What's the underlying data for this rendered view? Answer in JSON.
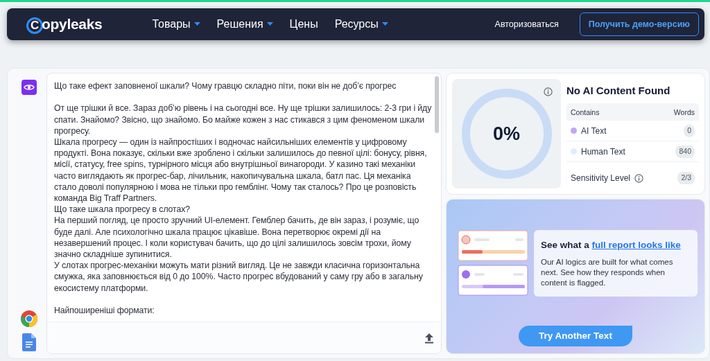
{
  "navbar": {
    "logo": "Copyleaks",
    "items": [
      {
        "label": "Товары",
        "dropdown": true
      },
      {
        "label": "Решения",
        "dropdown": true
      },
      {
        "label": "Цены",
        "dropdown": false
      },
      {
        "label": "Ресурсы",
        "dropdown": true
      }
    ],
    "login": "Авторизоваться",
    "demo_button": "Получить демо-версию"
  },
  "editor": {
    "paragraphs": [
      "Що таке ефект заповненої шкали? Чому гравцю складно піти, поки він не доб’є прогрес",
      "От ще трішки й все. Зараз доб’ю рівень і на сьогодні все. Ну ще трішки залишилось: 2-3 гри і йду спати. Знайомо? Звісно, що знайомо. Бо майже кожен з нас стикався з цим феноменом шкали прогресу.",
      "Шкала прогресу — один із найпростіших і водночас найсильніших елементів у цифровому продукті. Вона показує, скільки вже зроблено і скільки залишилось до певної цілі: бонусу, рівня, місії, статусу, free spins, турнірного місця або внутрішньої винагороди. У казино такі механіки часто виглядають як прогрес-бар, лічильник, накопичувальна шкала, батл пас. Ця механіка стало доволі популярною і мова не тільки про гемблінг. Чому так сталось? Про це розповість команда Big Traff Partners.",
      "Що таке шкала прогресу в слотах?",
      "На перший погляд, це просто зручний UI-елемент. Гемблер бачить, де він зараз, і розуміє, що буде далі. Але психологічно шкала працює цікавіше. Вона перетворює окремі дії на незавершений процес. І коли користувач бачить, що до цілі залишилось зовсім трохи, йому значно складніше зупинитися.",
      "У слотах прогрес-механіки можуть мати різний вигляд. Це не завжди класична горизонтальна смужка, яка заповнюється від 0 до 100%. Часто прогрес вбудований у саму гру або в загальну екосистему платформи.",
      "Найпоширеніші формати:"
    ],
    "blank_line_before": [
      false,
      true,
      false,
      false,
      false,
      false,
      true
    ]
  },
  "result": {
    "percent": "0%",
    "level": 0,
    "title": "No AI Content Found",
    "columns": [
      "Contains",
      "Words"
    ],
    "rows": [
      {
        "label": "AI Text",
        "count": "0",
        "color": "#c4a5f5"
      },
      {
        "label": "Human Text",
        "count": "840",
        "color": "#e3ebfb"
      }
    ],
    "sensitivity_label": "Sensitivity Level",
    "sensitivity_value": "2/3"
  },
  "promo": {
    "title_start": "See what a",
    "title_link": "full report looks like",
    "text": "Our AI logics are built for what comes next. See how they responds when content is flagged.",
    "button": "Try Another Text"
  }
}
